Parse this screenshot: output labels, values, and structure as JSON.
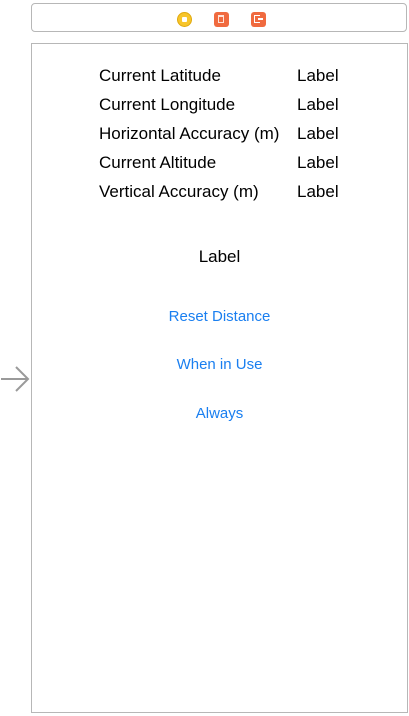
{
  "dock": {
    "icons": [
      "view-controller-icon",
      "first-responder-icon",
      "exit-icon"
    ]
  },
  "rows": [
    {
      "key": "Current Latitude",
      "value": "Label"
    },
    {
      "key": "Current Longitude",
      "value": "Label"
    },
    {
      "key": "Horizontal Accuracy (m)",
      "value": "Label"
    },
    {
      "key": "Current Altitude",
      "value": "Label"
    },
    {
      "key": "Vertical Accuracy (m)",
      "value": "Label"
    }
  ],
  "distance_label": "Label",
  "buttons": {
    "reset": "Reset Distance",
    "when_in_use": "When in Use",
    "always": "Always"
  },
  "colors": {
    "button_tint": "#1a7ff0",
    "view_controller_icon": "#f7c52b",
    "dock_accent": "#f06a3f",
    "scene_border": "#b7b7b7"
  }
}
